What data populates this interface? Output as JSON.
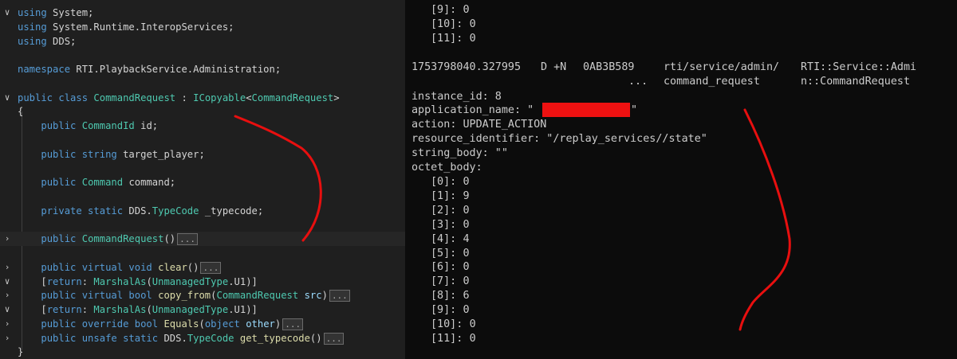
{
  "editor": {
    "lines": [
      {
        "gutter": "∨",
        "segments": [
          {
            "c": "kw",
            "t": "using "
          },
          {
            "c": "pl",
            "t": "System;"
          }
        ]
      },
      {
        "gutter": "",
        "segments": [
          {
            "c": "kw",
            "t": "using "
          },
          {
            "c": "pl",
            "t": "System.Runtime.InteropServices;"
          }
        ]
      },
      {
        "gutter": "",
        "segments": [
          {
            "c": "kw",
            "t": "using "
          },
          {
            "c": "pl",
            "t": "DDS;"
          }
        ]
      },
      {
        "gutter": "",
        "segments": []
      },
      {
        "gutter": "",
        "segments": [
          {
            "c": "kw",
            "t": "namespace "
          },
          {
            "c": "pl",
            "t": "RTI.PlaybackService.Administration;"
          }
        ]
      },
      {
        "gutter": "",
        "segments": []
      },
      {
        "gutter": "∨",
        "segments": [
          {
            "c": "kw",
            "t": "public class "
          },
          {
            "c": "ty",
            "t": "CommandRequest"
          },
          {
            "c": "pl",
            "t": " : "
          },
          {
            "c": "ty",
            "t": "ICopyable"
          },
          {
            "c": "pl",
            "t": "<"
          },
          {
            "c": "ty",
            "t": "CommandRequest"
          },
          {
            "c": "pl",
            "t": ">"
          }
        ]
      },
      {
        "gutter": "",
        "segments": [
          {
            "c": "pl",
            "t": "{"
          }
        ]
      },
      {
        "gutter": "",
        "segments": [
          {
            "c": "pl",
            "t": "    "
          },
          {
            "c": "kw",
            "t": "public "
          },
          {
            "c": "ty",
            "t": "CommandId"
          },
          {
            "c": "pl",
            "t": " id;"
          }
        ]
      },
      {
        "gutter": "",
        "segments": []
      },
      {
        "gutter": "",
        "segments": [
          {
            "c": "pl",
            "t": "    "
          },
          {
            "c": "kw",
            "t": "public string "
          },
          {
            "c": "pl",
            "t": "target_player;"
          }
        ]
      },
      {
        "gutter": "",
        "segments": []
      },
      {
        "gutter": "",
        "segments": [
          {
            "c": "pl",
            "t": "    "
          },
          {
            "c": "kw",
            "t": "public "
          },
          {
            "c": "ty",
            "t": "Command"
          },
          {
            "c": "pl",
            "t": " command;"
          }
        ]
      },
      {
        "gutter": "",
        "segments": []
      },
      {
        "gutter": "",
        "segments": [
          {
            "c": "pl",
            "t": "    "
          },
          {
            "c": "kw",
            "t": "private static "
          },
          {
            "c": "pl",
            "t": "DDS."
          },
          {
            "c": "ty",
            "t": "TypeCode"
          },
          {
            "c": "pl",
            "t": " _typecode;"
          }
        ]
      },
      {
        "gutter": "",
        "segments": []
      },
      {
        "gutter": "›",
        "hl": true,
        "segments": [
          {
            "c": "pl",
            "t": "    "
          },
          {
            "c": "kw",
            "t": "public "
          },
          {
            "c": "ty",
            "t": "CommandRequest"
          },
          {
            "c": "pl",
            "t": "()"
          }
        ],
        "fold": "..."
      },
      {
        "gutter": "",
        "segments": []
      },
      {
        "gutter": "›",
        "segments": [
          {
            "c": "pl",
            "t": "    "
          },
          {
            "c": "kw",
            "t": "public virtual void "
          },
          {
            "c": "fn",
            "t": "clear"
          },
          {
            "c": "pl",
            "t": "()"
          }
        ],
        "fold": "..."
      },
      {
        "gutter": "∨",
        "segments": [
          {
            "c": "pl",
            "t": "    ["
          },
          {
            "c": "kw",
            "t": "return"
          },
          {
            "c": "pl",
            "t": ": "
          },
          {
            "c": "ty",
            "t": "MarshalAs"
          },
          {
            "c": "pl",
            "t": "("
          },
          {
            "c": "ty",
            "t": "UnmanagedType"
          },
          {
            "c": "pl",
            "t": ".U1)]"
          }
        ]
      },
      {
        "gutter": "›",
        "segments": [
          {
            "c": "pl",
            "t": "    "
          },
          {
            "c": "kw",
            "t": "public virtual bool "
          },
          {
            "c": "fn",
            "t": "copy_from"
          },
          {
            "c": "pl",
            "t": "("
          },
          {
            "c": "ty",
            "t": "CommandRequest"
          },
          {
            "c": "pl",
            "t": " "
          },
          {
            "c": "pm",
            "t": "src"
          },
          {
            "c": "pl",
            "t": ")"
          }
        ],
        "fold": "..."
      },
      {
        "gutter": "∨",
        "segments": [
          {
            "c": "pl",
            "t": "    ["
          },
          {
            "c": "kw",
            "t": "return"
          },
          {
            "c": "pl",
            "t": ": "
          },
          {
            "c": "ty",
            "t": "MarshalAs"
          },
          {
            "c": "pl",
            "t": "("
          },
          {
            "c": "ty",
            "t": "UnmanagedType"
          },
          {
            "c": "pl",
            "t": ".U1)]"
          }
        ]
      },
      {
        "gutter": "›",
        "segments": [
          {
            "c": "pl",
            "t": "    "
          },
          {
            "c": "kw",
            "t": "public override bool "
          },
          {
            "c": "fn",
            "t": "Equals"
          },
          {
            "c": "pl",
            "t": "("
          },
          {
            "c": "kw",
            "t": "object"
          },
          {
            "c": "pl",
            "t": " "
          },
          {
            "c": "pm",
            "t": "other"
          },
          {
            "c": "pl",
            "t": ")"
          }
        ],
        "fold": "..."
      },
      {
        "gutter": "›",
        "segments": [
          {
            "c": "pl",
            "t": "    "
          },
          {
            "c": "kw",
            "t": "public unsafe static "
          },
          {
            "c": "pl",
            "t": "DDS."
          },
          {
            "c": "ty",
            "t": "TypeCode"
          },
          {
            "c": "pl",
            "t": " "
          },
          {
            "c": "fn",
            "t": "get_typecode"
          },
          {
            "c": "pl",
            "t": "()"
          }
        ],
        "fold": "..."
      },
      {
        "gutter": "",
        "segments": [
          {
            "c": "pl",
            "t": "}"
          }
        ]
      }
    ]
  },
  "terminal": {
    "top_items": [
      {
        "k": "[9]:",
        "v": "0"
      },
      {
        "k": "[10]:",
        "v": "0"
      },
      {
        "k": "[11]:",
        "v": "0"
      }
    ],
    "header": {
      "timestamp": "1753798040.327995",
      "flags": "D +N",
      "guid": "0AB3B589",
      "ellipsis": "...",
      "topic_line1": "rti/service/admin/",
      "topic_line2": "command_request",
      "type_line1": "RTI::Service::Admi",
      "type_line2": "n::CommandRequest"
    },
    "instance_id": "instance_id: 8",
    "application_name_label": "application_name: \"",
    "application_name_close": "\"",
    "action": "action: UPDATE_ACTION",
    "resource_identifier": "resource_identifier: \"/replay_services//state\"",
    "string_body": "string_body: \"\"",
    "octet_body_label": "octet_body:",
    "octet_items": [
      {
        "k": "[0]:",
        "v": "0"
      },
      {
        "k": "[1]:",
        "v": "9"
      },
      {
        "k": "[2]:",
        "v": "0"
      },
      {
        "k": "[3]:",
        "v": "0"
      },
      {
        "k": "[4]:",
        "v": "4"
      },
      {
        "k": "[5]:",
        "v": "0"
      },
      {
        "k": "[6]:",
        "v": "0"
      },
      {
        "k": "[7]:",
        "v": "0"
      },
      {
        "k": "[8]:",
        "v": "6"
      },
      {
        "k": "[9]:",
        "v": "0"
      },
      {
        "k": "[10]:",
        "v": "0"
      },
      {
        "k": "[11]:",
        "v": "0"
      }
    ]
  }
}
